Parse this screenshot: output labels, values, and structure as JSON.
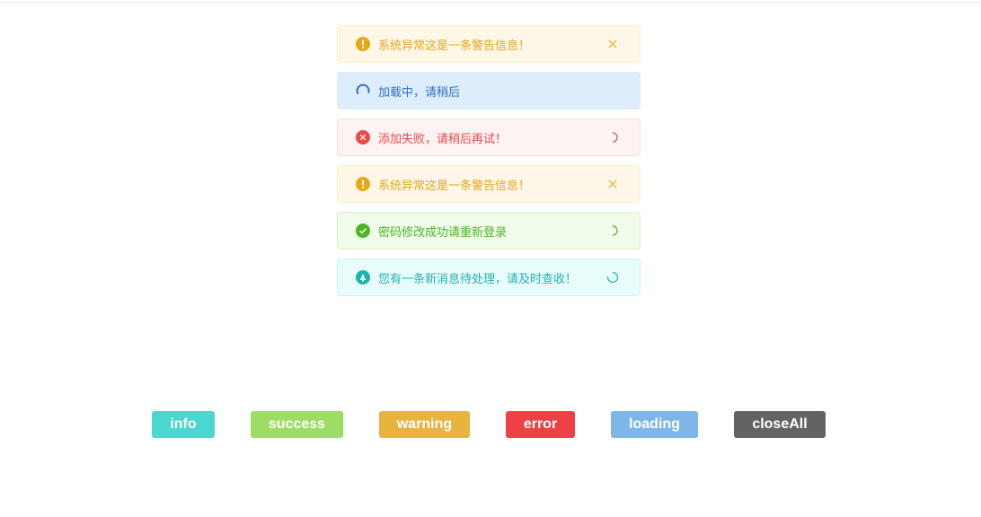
{
  "toasts": [
    {
      "type": "warning",
      "message": "系统异常这是一条警告信息！",
      "icon": "exclamation-circle-icon",
      "action": "close-icon"
    },
    {
      "type": "info",
      "message": "加载中，请稍后",
      "icon": "loading-spinner-icon",
      "action": null
    },
    {
      "type": "error",
      "message": "添加失败，请稍后再试！",
      "icon": "x-circle-icon",
      "action": "spinner-icon"
    },
    {
      "type": "warning",
      "message": "系统异常这是一条警告信息！",
      "icon": "exclamation-circle-icon",
      "action": "close-icon"
    },
    {
      "type": "success",
      "message": "密码修改成功请重新登录",
      "icon": "check-circle-icon",
      "action": "spinner-icon"
    },
    {
      "type": "notice",
      "message": "您有一条新消息待处理，请及时查收！",
      "icon": "bell-circle-icon",
      "action": "spinner-icon"
    }
  ],
  "buttons": {
    "info": "info",
    "success": "success",
    "warning": "warning",
    "error": "error",
    "loading": "loading",
    "closeAll": "closeAll"
  },
  "colors": {
    "warning": "#e6a817",
    "info": "#2f6fc4",
    "error": "#ec4a4a",
    "success": "#4cb526",
    "notice": "#1fb3ad",
    "btn_info": "#4bd6cf",
    "btn_success": "#9ddd64",
    "btn_warning": "#e8b33e",
    "btn_error": "#ee4146",
    "btn_loading": "#7fb6e8",
    "btn_closeall": "#636363"
  }
}
